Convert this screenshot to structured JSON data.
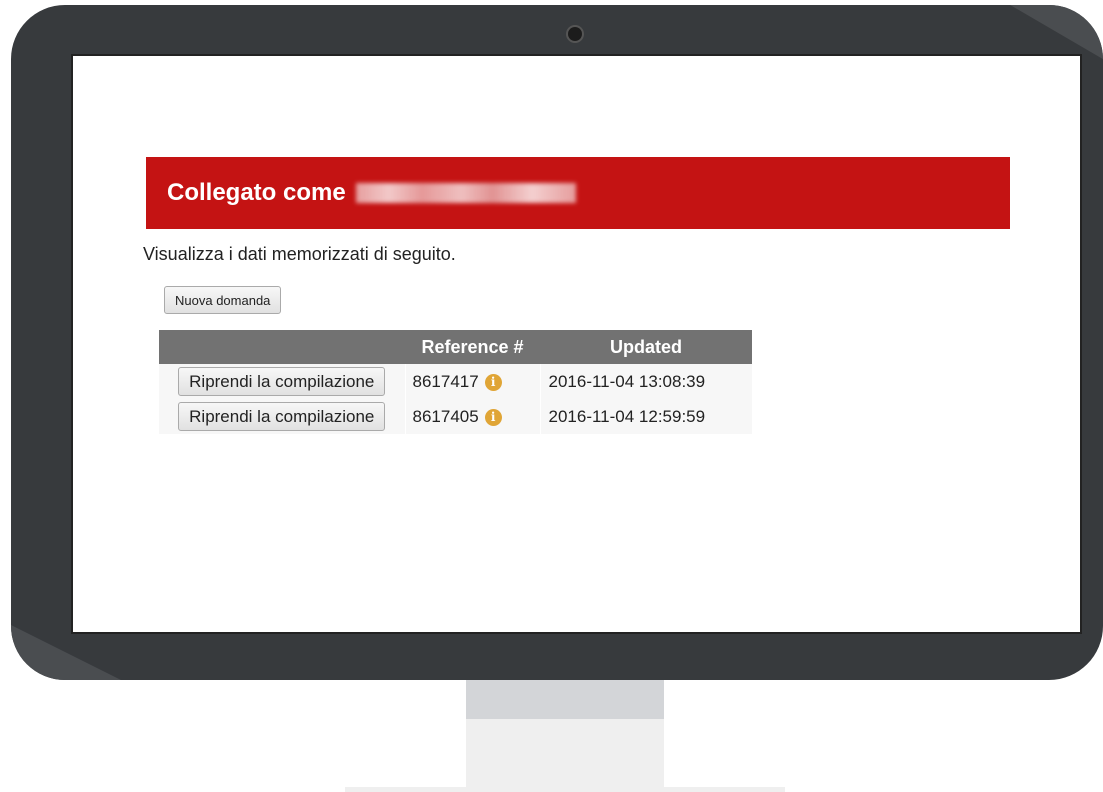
{
  "banner": {
    "logged_in_as": "Collegato come"
  },
  "intro_text": "Visualizza i dati memorizzati di seguito.",
  "new_application_button": "Nuova domanda",
  "table": {
    "headers": [
      "",
      "Reference #",
      "Updated"
    ],
    "rows": [
      {
        "action": "Riprendi la compilazione",
        "reference": "8617417",
        "updated": "2016-11-04 13:08:39"
      },
      {
        "action": "Riprendi la compilazione",
        "reference": "8617405",
        "updated": "2016-11-04 12:59:59"
      }
    ]
  },
  "icons": {
    "info": "info-icon",
    "info_glyph": "i",
    "info_color": "#e0a536"
  },
  "colors": {
    "banner_bg": "#c41313",
    "table_header_bg": "#727272",
    "bezel": "#373a3d"
  }
}
